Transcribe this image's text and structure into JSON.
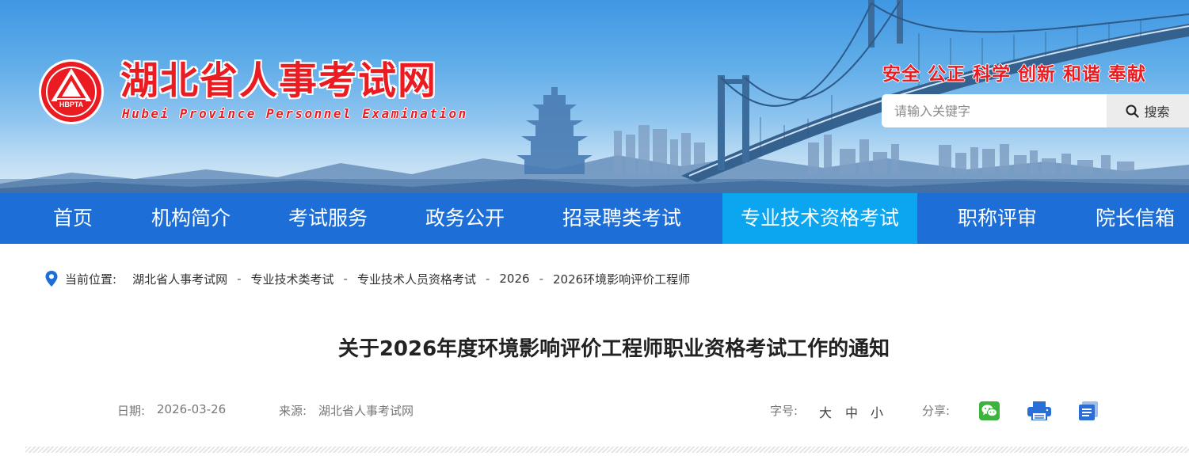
{
  "header": {
    "logo_text": "HBPTA",
    "title": "湖北省人事考试网",
    "subtitle": "Hubei Province Personnel Examination",
    "slogan": "安全 公正 科学 创新 和谐 奉献",
    "search": {
      "placeholder": "请输入关键字",
      "value": "",
      "button_label": "搜索",
      "icon": "search-icon"
    }
  },
  "nav": {
    "items": [
      {
        "label": "首页"
      },
      {
        "label": "机构简介"
      },
      {
        "label": "考试服务"
      },
      {
        "label": "政务公开"
      },
      {
        "label": "招录聘类考试"
      },
      {
        "label": "专业技术资格考试",
        "active": true
      },
      {
        "label": "职称评审"
      },
      {
        "label": "院长信箱"
      }
    ]
  },
  "breadcrumb": {
    "icon": "location-pin-icon",
    "label": "当前位置:",
    "items": [
      "湖北省人事考试网",
      "专业技术类考试",
      "专业技术人员资格考试",
      "2026",
      "2026环境影响评价工程师"
    ],
    "separator": "-"
  },
  "article": {
    "title": "关于2026年度环境影响评价工程师职业资格考试工作的通知",
    "date_label": "日期:",
    "date": "2026-03-26",
    "source_label": "来源:",
    "source": "湖北省人事考试网",
    "font_size_label": "字号:",
    "font_sizes": [
      "大",
      "中",
      "小"
    ],
    "share_label": "分享:",
    "share_icons": [
      "wechat-icon",
      "print-icon",
      "article-copy-icon"
    ]
  },
  "colors": {
    "nav_bg": "#1d6fd7",
    "nav_active_bg": "#0ba5f0",
    "brand_red": "#ea1c22",
    "wechat_green": "#3cb43c",
    "share_blue": "#2a6fd6"
  }
}
